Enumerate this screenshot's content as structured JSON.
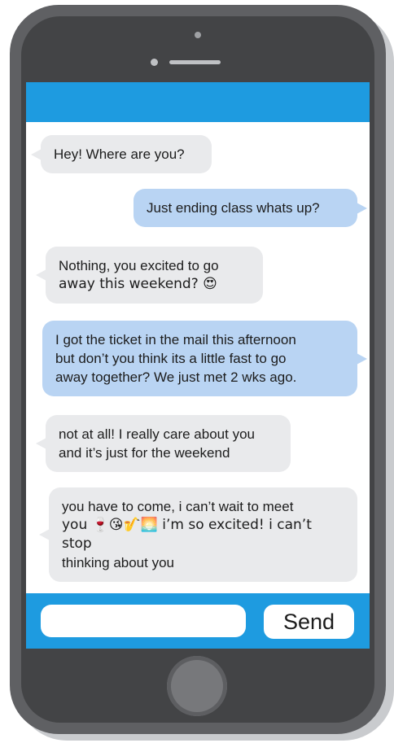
{
  "chat": {
    "messages": [
      {
        "direction": "in",
        "lines": [
          "Hey! Where are you?"
        ]
      },
      {
        "direction": "out",
        "lines": [
          "Just ending class whats up?"
        ]
      },
      {
        "direction": "in",
        "lines": [
          "Nothing, you excited to go",
          "away this weekend? 😍"
        ]
      },
      {
        "direction": "out",
        "lines": [
          "I got the ticket in the mail this afternoon",
          "but don’t you think its a little fast to go",
          "away together? We just met 2 wks ago."
        ]
      },
      {
        "direction": "in",
        "lines": [
          "not at all! I really care about you",
          "and it’s just for the weekend"
        ]
      },
      {
        "direction": "in",
        "lines": [
          "you have to come, i can’t wait to meet",
          "you 🍷😘🎷🌅 i’m so excited! i can’t stop",
          "thinking about you"
        ]
      }
    ]
  },
  "composer": {
    "placeholder": "",
    "value": "",
    "send_label": "Send"
  },
  "colors": {
    "accent": "#1e9be0",
    "incoming_bubble": "#e9eaec",
    "outgoing_bubble": "#b9d4f3",
    "phone_body": "#5f6063"
  }
}
